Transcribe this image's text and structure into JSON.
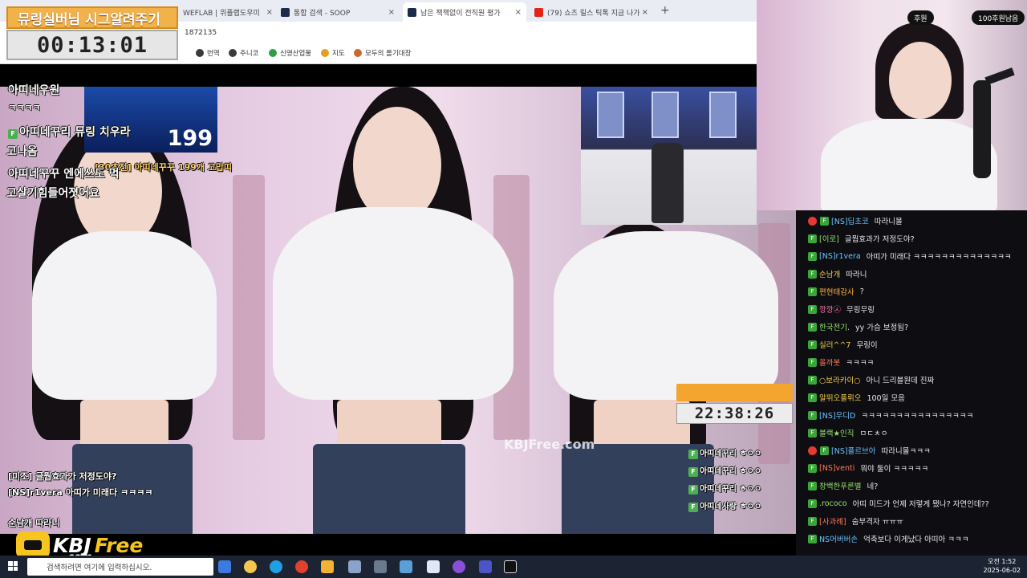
{
  "browser": {
    "tabs": [
      {
        "label": "WEFLAB | 위플랩도우미",
        "active": false
      },
      {
        "label": "통합 검색 - SOOP",
        "active": false
      },
      {
        "label": "남은 책책없이 전직원 평가",
        "active": true
      },
      {
        "label": "(79) 쇼츠 릴스 틱톡 지금 나가",
        "active": false
      }
    ],
    "address_fragment": "1872135",
    "bookmarks": [
      "번역",
      "주니코",
      "신영산업물",
      "지도",
      "모두의 롤기대장"
    ]
  },
  "overlay": {
    "mission_title": "뮤링실버님 시그알려주기",
    "timer": "00:13:01",
    "clock2": "22:38:26",
    "watermark": "KBJFree.com",
    "inset_number": "199"
  },
  "video_chat": [
    {
      "text": "아띠네우원",
      "big": true
    },
    {
      "text": "ㅋㅋㅋㅋ",
      "big": false
    },
    {
      "text": "아띠네꾸리 뮤링 치우라",
      "big": true
    },
    {
      "text": "고나옴",
      "big": true
    },
    {
      "text": "[30초전] 아띠네꾸꾸 199개 고맙띠",
      "big": false
    },
    {
      "text": "아띠네꾸꾸 엔에쓰도 먹",
      "big": true
    },
    {
      "text": "고살기힘들어졋어요",
      "big": true
    },
    {
      "text": "[미조] 글뭡효과가 저정도야?",
      "big": false
    },
    {
      "text": "[NS]r1vera 아띠가 미래다 ㅋㅋㅋㅋ",
      "big": false
    },
    {
      "text": "순남개 따라니",
      "big": false
    }
  ],
  "video_chat_small": [
    "아띠네꾸리 ㅎㅇㅇ",
    "아띠네꾸리 ㅎㅇㅇ",
    "아띠네꾸리 ㅎㅇㅇ",
    "아띠네사랑 ㅎㅇㅇ"
  ],
  "cam": {
    "label_left": "후원",
    "label_right": "100후원남음"
  },
  "chat": [
    {
      "badge": "heart",
      "nick": "[NS]딥초코",
      "nick_color": "#6ec3ff",
      "msg": "따라니몰"
    },
    {
      "badge": "f",
      "nick": "[이로]",
      "nick_color": "#9be36c",
      "msg": "글뭡효과가 저정도야?"
    },
    {
      "badge": "f",
      "nick": "[NS]r1vera",
      "nick_color": "#6ec3ff",
      "msg": "아띠가 미래다 ㅋㅋㅋㅋㅋㅋㅋㅋㅋㅋㅋㅋㅋㅋ"
    },
    {
      "badge": "f",
      "nick": "순남개",
      "nick_color": "#f2d04b",
      "msg": "따라니"
    },
    {
      "badge": "f",
      "nick": "편현태감사",
      "nick_color": "#ffb347",
      "msg": "?"
    },
    {
      "badge": "f",
      "nick": "깡깡㉦",
      "nick_color": "#ff7aa8",
      "msg": "무링무링"
    },
    {
      "badge": "f",
      "nick": "한국전기.",
      "nick_color": "#9be36c",
      "msg": "yy 가슴 보정됨?"
    },
    {
      "badge": "f",
      "nick": "실러^^7",
      "nick_color": "#f2d04b",
      "msg": "무링이"
    },
    {
      "badge": "f",
      "nick": "올까봇",
      "nick_color": "#ff7a5c",
      "msg": "ㅋㅋㅋㅋ"
    },
    {
      "badge": "f",
      "nick": "○보라카이○",
      "nick_color": "#f2d04b",
      "msg": "아니 드리블원데 진짜"
    },
    {
      "badge": "f",
      "nick": "알뛰오플뤼오",
      "nick_color": "#f2d04b",
      "msg": "100일 모음"
    },
    {
      "badge": "f",
      "nick": "[NS]우디D",
      "nick_color": "#6ec3ff",
      "msg": "ㅋㅋㅋㅋㅋㅋㅋㅋㅋㅋㅋㅋㅋㅋㅋㅋ"
    },
    {
      "badge": "f",
      "nick": "블랙★인직",
      "nick_color": "#9be36c",
      "msg": "ㅁㄷㅊㅇ"
    },
    {
      "badge": "heart",
      "nick": "[NS]플르브아",
      "nick_color": "#6ec3ff",
      "msg": "따라니몰ㅋㅋㅋ"
    },
    {
      "badge": "f",
      "nick": "[NS]venti",
      "nick_color": "#ff7a5c",
      "msg": "뭐야 둘이 ㅋㅋㅋㅋㅋ"
    },
    {
      "badge": "f",
      "nick": "창백한푸른별",
      "nick_color": "#9be36c",
      "msg": "네?"
    },
    {
      "badge": "f",
      "nick": ".rococo",
      "nick_color": "#9be36c",
      "msg": "아띠 미드가 언제 저렇게 됐나? 자연인데??"
    },
    {
      "badge": "f",
      "nick": "[사과례]",
      "nick_color": "#ff7a5c",
      "msg": "숨부격자 ㅠㅠㅠ"
    },
    {
      "badge": "f",
      "nick": "NS어버버손",
      "nick_color": "#6ec3ff",
      "msg": "억축보다 이게났다 아띠아 ㅋㅋㅋ"
    }
  ],
  "logo": {
    "kbj": "KBJ",
    "free": "Free",
    "com": ".com"
  },
  "taskbar": {
    "search_placeholder": "검색하려면 여기에 입력하십시오.",
    "time": "오전 1:52",
    "date": "2025-06-02"
  }
}
